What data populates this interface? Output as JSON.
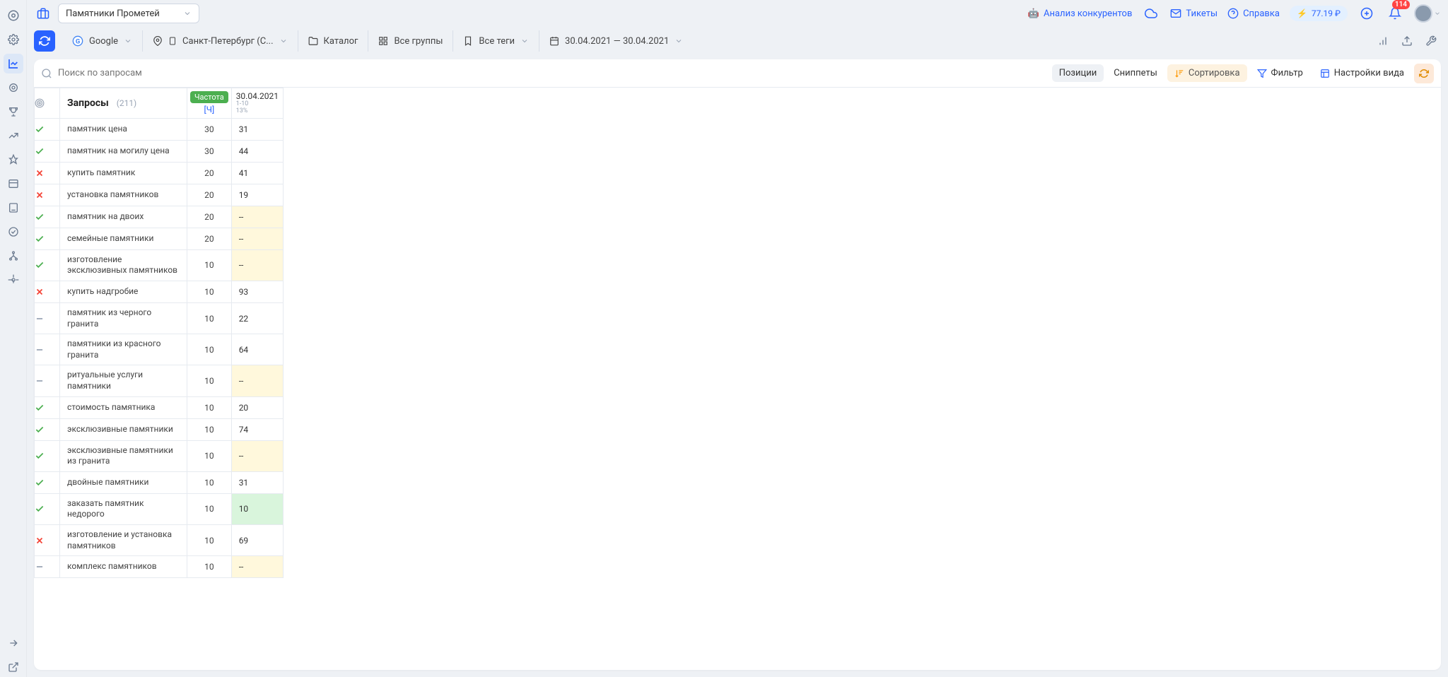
{
  "project_name": "Памятники Прометей",
  "top": {
    "analysis": "Анализ конкурентов",
    "tickets": "Тикеты",
    "help": "Справка",
    "balance": "77.19 ₽",
    "notif_count": "114"
  },
  "filters": {
    "engine": "Google",
    "region": "Санкт-Петербург (С...",
    "catalog": "Каталог",
    "groups": "Все группы",
    "tags": "Все теги",
    "date": "30.04.2021 — 30.04.2021"
  },
  "toolbar": {
    "search_placeholder": "Поиск по запросам",
    "positions": "Позиции",
    "snippets": "Сниппеты",
    "sort": "Сортировка",
    "filter": "Фильтр",
    "view": "Настройки вида"
  },
  "headers": {
    "queries": "Запросы",
    "count": "(211)",
    "freq": "Частота",
    "freq_sub": "[Ч]",
    "date": "30.04.2021",
    "date_meta1": "1-10",
    "date_meta2": "13%"
  },
  "rows": [
    {
      "status": "check",
      "query": "памятник цена",
      "freq": "30",
      "pos": "31",
      "cls": ""
    },
    {
      "status": "check",
      "query": "памятник на могилу цена",
      "freq": "30",
      "pos": "44",
      "cls": ""
    },
    {
      "status": "x",
      "query": "купить памятник",
      "freq": "20",
      "pos": "41",
      "cls": ""
    },
    {
      "status": "x",
      "query": "установка памятников",
      "freq": "20",
      "pos": "19",
      "cls": ""
    },
    {
      "status": "check",
      "query": "памятник на двоих",
      "freq": "20",
      "pos": "--",
      "cls": "yellow"
    },
    {
      "status": "check",
      "query": "семейные памятники",
      "freq": "20",
      "pos": "--",
      "cls": "yellow"
    },
    {
      "status": "check",
      "query": "изготовление эксклюзивных памятников",
      "freq": "10",
      "pos": "--",
      "cls": "yellow"
    },
    {
      "status": "x",
      "query": "купить надгробие",
      "freq": "10",
      "pos": "93",
      "cls": ""
    },
    {
      "status": "dash",
      "query": "памятник из черного гранита",
      "freq": "10",
      "pos": "22",
      "cls": ""
    },
    {
      "status": "dash",
      "query": "памятники из красного гранита",
      "freq": "10",
      "pos": "64",
      "cls": ""
    },
    {
      "status": "dash",
      "query": "ритуальные услуги памятники",
      "freq": "10",
      "pos": "--",
      "cls": "yellow"
    },
    {
      "status": "check",
      "query": "стоимость памятника",
      "freq": "10",
      "pos": "20",
      "cls": ""
    },
    {
      "status": "check",
      "query": "эксклюзивные памятники",
      "freq": "10",
      "pos": "74",
      "cls": ""
    },
    {
      "status": "check",
      "query": "эксклюзивные памятники из гранита",
      "freq": "10",
      "pos": "--",
      "cls": "yellow"
    },
    {
      "status": "check",
      "query": "двойные памятники",
      "freq": "10",
      "pos": "31",
      "cls": ""
    },
    {
      "status": "check",
      "query": "заказать памятник недорого",
      "freq": "10",
      "pos": "10",
      "cls": "green"
    },
    {
      "status": "x",
      "query": "изготовление и установка памятников",
      "freq": "10",
      "pos": "69",
      "cls": ""
    },
    {
      "status": "dash",
      "query": "комплекс памятников",
      "freq": "10",
      "pos": "--",
      "cls": "yellow"
    }
  ]
}
